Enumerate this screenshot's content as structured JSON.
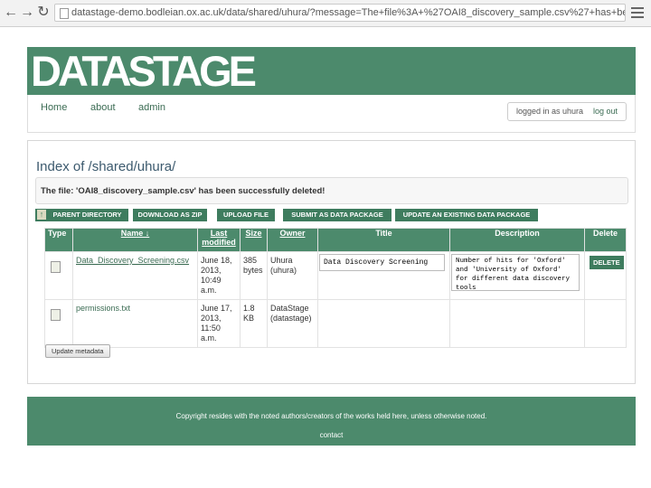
{
  "browser": {
    "url": "datastage-demo.bodleian.ox.ac.uk/data/shared/uhura/?message=The+file%3A+%27OAI8_discovery_sample.csv%27+has+been+successfully+..."
  },
  "header": {
    "logo": "DATASTAGE",
    "nav": [
      "Home",
      "about",
      "admin"
    ],
    "login_text": "logged in as uhura",
    "logout_label": "log out"
  },
  "content": {
    "title": "Index of /shared/uhura/",
    "message": "The file: 'OAI8_discovery_sample.csv' has been successfully deleted!",
    "toolbar": {
      "parent": "PARENT DIRECTORY",
      "download": "DOWNLOAD AS ZIP",
      "upload": "UPLOAD FILE",
      "submit": "SUBMIT AS DATA PACKAGE",
      "update_pkg": "UPDATE AN EXISTING DATA PACKAGE"
    },
    "table": {
      "headers": {
        "type": "Type",
        "name": "Name ↓",
        "modified": "Last modified",
        "size": "Size",
        "owner": "Owner",
        "title": "Title",
        "description": "Description",
        "delete": "Delete"
      },
      "rows": [
        {
          "name": "Data_Discovery_Screening.csv",
          "modified": "June 18, 2013, 10:49 a.m.",
          "size": "385 bytes",
          "owner": "Uhura (uhura)",
          "title_value": "Data Discovery Screening",
          "description_value": "Number of hits for 'Oxford' and 'University of Oxford' for different data discovery tools",
          "delete_label": "DELETE"
        },
        {
          "name": "permissions.txt",
          "modified": "June 17, 2013, 11:50 a.m.",
          "size": "1.8 KB",
          "owner": "DataStage (datastage)"
        }
      ]
    },
    "update_metadata": "Update metadata"
  },
  "footer": {
    "copyright": "Copyright resides with the noted authors/creators of the works held here, unless otherwise noted.",
    "contact": "contact"
  },
  "colors": {
    "brand_green": "#4c8a6c",
    "button_green": "#3e7c5e"
  }
}
